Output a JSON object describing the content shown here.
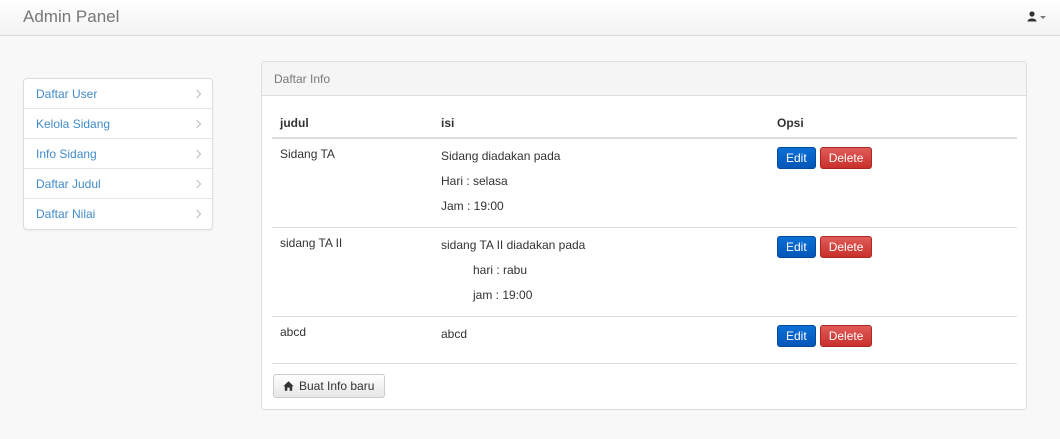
{
  "app": {
    "title": "Admin Panel"
  },
  "sidebar": {
    "items": [
      {
        "label": "Daftar User"
      },
      {
        "label": "Kelola Sidang"
      },
      {
        "label": "Info Sidang"
      },
      {
        "label": "Daftar Judul"
      },
      {
        "label": "Daftar Nilai"
      }
    ]
  },
  "panel": {
    "heading": "Daftar Info",
    "columns": {
      "judul": "judul",
      "isi": "isi",
      "opsi": "Opsi"
    },
    "rows": [
      {
        "judul": "Sidang TA",
        "isi": [
          "Sidang diadakan pada",
          "Hari : selasa",
          "Jam : 19:00"
        ]
      },
      {
        "judul": "sidang TA II",
        "isi": [
          "sidang TA II diadakan pada",
          "hari : rabu",
          "jam : 19:00"
        ]
      },
      {
        "judul": "abcd",
        "isi": [
          "abcd"
        ]
      }
    ],
    "edit_label": "Edit",
    "delete_label": "Delete",
    "new_button_label": "Buat Info baru"
  },
  "colors": {
    "primary": "#0a6fd6",
    "danger": "#d9534f",
    "link": "#428bca"
  },
  "icons": {
    "user": "user-icon",
    "home": "home-icon",
    "chevron": "chevron-right-icon"
  }
}
